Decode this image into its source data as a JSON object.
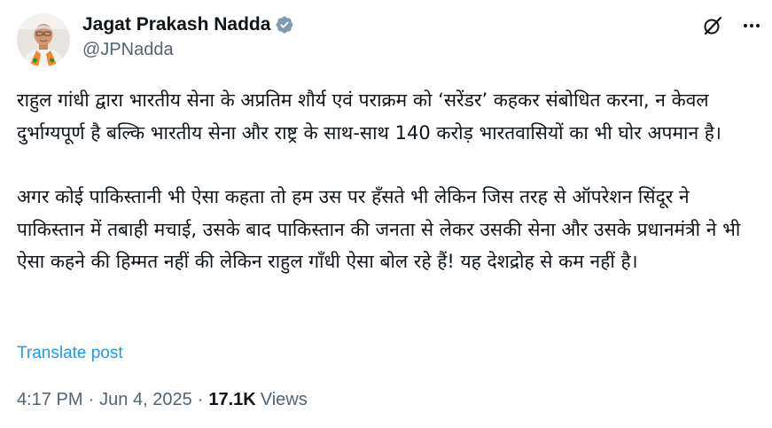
{
  "author": {
    "display_name": "Jagat Prakash Nadda",
    "handle": "@JPNadda",
    "verified_icon": "verified-badge-icon",
    "avatar": "avatar-portrait"
  },
  "actions": {
    "grok_icon": "grok-icon",
    "more_icon": "more-icon"
  },
  "post": {
    "paragraphs": [
      "राहुल गांधी द्वारा भारतीय सेना के अप्रतिम शौर्य एवं पराक्रम को ‘सरेंडर’ कहकर संबोधित करना, न केवल दुर्भाग्यपूर्ण है बल्कि भारतीय सेना और राष्ट्र के साथ-साथ 140 करोड़ भारतवासियों का भी घोर अपमान है।",
      "अगर कोई पाकिस्तानी भी ऐसा कहता तो हम उस पर हँसते भी लेकिन जिस तरह से ऑपरेशन सिंदूर ने पाकिस्तान में तबाही मचाई, उसके बाद पाकिस्तान की जनता से लेकर उसकी सेना और उसके प्रधानमंत्री ने भी ऐसा कहने की हिम्मत नहीं की लेकिन राहुल गाँधी ऐसा बोल रहे हैं! यह देशद्रोह से कम नहीं है।"
    ],
    "translate_label": "Translate post"
  },
  "meta": {
    "time": "4:17 PM",
    "separator": "·",
    "date": "Jun 4, 2025",
    "views_count": "17.1K",
    "views_label": "Views"
  },
  "colors": {
    "text": "#0f1419",
    "secondary": "#536471",
    "link": "#1d9bf0",
    "verified": "#829aab"
  }
}
